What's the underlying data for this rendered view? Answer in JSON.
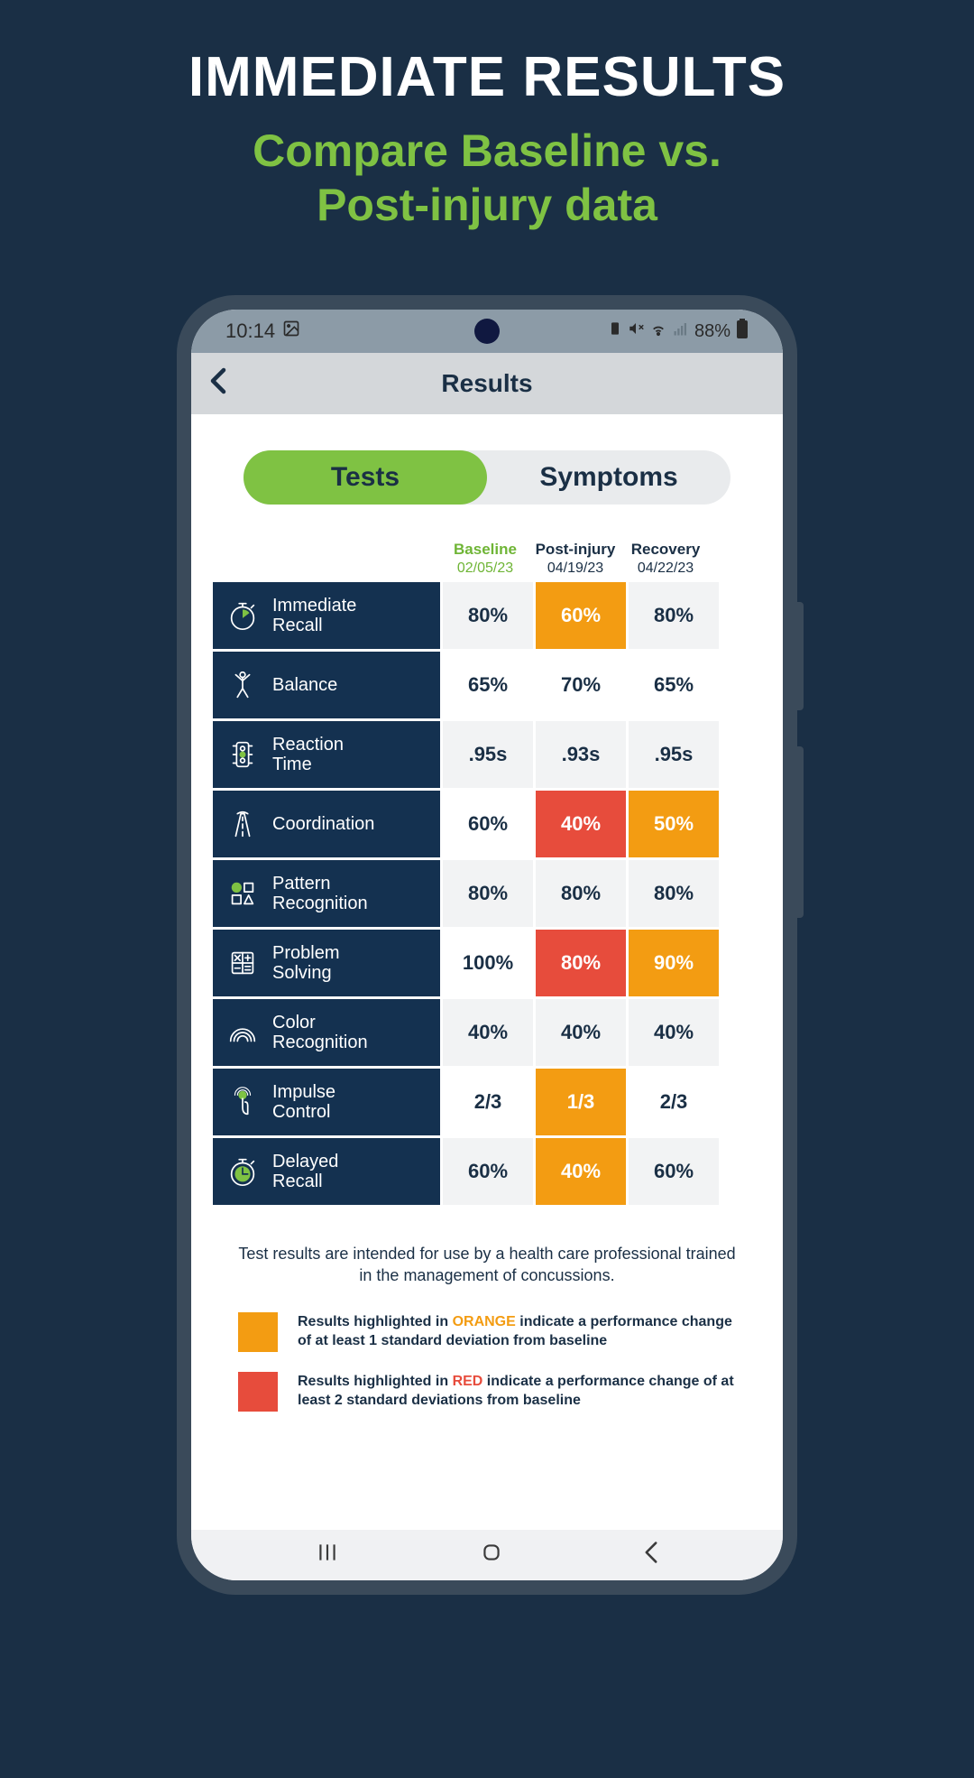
{
  "promo": {
    "title": "IMMEDIATE RESULTS",
    "subtitle_l1": "Compare Baseline vs.",
    "subtitle_l2": "Post-injury data"
  },
  "status": {
    "time": "10:14",
    "battery": "88%"
  },
  "header": {
    "title": "Results"
  },
  "segments": {
    "tests": "Tests",
    "symptoms": "Symptoms"
  },
  "columns": [
    {
      "title": "Baseline",
      "date": "02/05/23"
    },
    {
      "title": "Post-injury",
      "date": "04/19/23"
    },
    {
      "title": "Recovery",
      "date": "04/22/23"
    }
  ],
  "rows": [
    {
      "icon": "stopwatch",
      "name_l1": "Immediate",
      "name_l2": "Recall",
      "cells": [
        {
          "v": "80%",
          "s": ""
        },
        {
          "v": "60%",
          "s": "orange"
        },
        {
          "v": "80%",
          "s": ""
        }
      ]
    },
    {
      "icon": "balance",
      "name_l1": "Balance",
      "name_l2": "",
      "cells": [
        {
          "v": "65%",
          "s": ""
        },
        {
          "v": "70%",
          "s": ""
        },
        {
          "v": "65%",
          "s": ""
        }
      ]
    },
    {
      "icon": "traffic",
      "name_l1": "Reaction",
      "name_l2": "Time",
      "cells": [
        {
          "v": ".95s",
          "s": ""
        },
        {
          "v": ".93s",
          "s": ""
        },
        {
          "v": ".95s",
          "s": ""
        }
      ]
    },
    {
      "icon": "road",
      "name_l1": "Coordination",
      "name_l2": "",
      "cells": [
        {
          "v": "60%",
          "s": ""
        },
        {
          "v": "40%",
          "s": "red"
        },
        {
          "v": "50%",
          "s": "orange"
        }
      ]
    },
    {
      "icon": "shapes",
      "name_l1": "Pattern",
      "name_l2": "Recognition",
      "cells": [
        {
          "v": "80%",
          "s": ""
        },
        {
          "v": "80%",
          "s": ""
        },
        {
          "v": "80%",
          "s": ""
        }
      ]
    },
    {
      "icon": "calc",
      "name_l1": "Problem",
      "name_l2": "Solving",
      "cells": [
        {
          "v": "100%",
          "s": ""
        },
        {
          "v": "80%",
          "s": "red"
        },
        {
          "v": "90%",
          "s": "orange"
        }
      ]
    },
    {
      "icon": "rainbow",
      "name_l1": "Color",
      "name_l2": "Recognition",
      "cells": [
        {
          "v": "40%",
          "s": ""
        },
        {
          "v": "40%",
          "s": ""
        },
        {
          "v": "40%",
          "s": ""
        }
      ]
    },
    {
      "icon": "tap",
      "name_l1": "Impulse",
      "name_l2": "Control",
      "cells": [
        {
          "v": "2/3",
          "s": ""
        },
        {
          "v": "1/3",
          "s": "orange"
        },
        {
          "v": "2/3",
          "s": ""
        }
      ]
    },
    {
      "icon": "stopwatch2",
      "name_l1": "Delayed",
      "name_l2": "Recall",
      "cells": [
        {
          "v": "60%",
          "s": ""
        },
        {
          "v": "40%",
          "s": "orange"
        },
        {
          "v": "60%",
          "s": ""
        }
      ]
    }
  ],
  "disclaimer": "Test results are intended for use by a health care professional trained in the management of concussions.",
  "legend": {
    "orange_pre": "Results highlighted in ",
    "orange_kw": "ORANGE",
    "orange_post": " indicate a performance change of at least 1 standard deviation from baseline",
    "red_pre": "Results highlighted in ",
    "red_kw": "RED",
    "red_post": " indicate a performance change of at least 2 standard deviations from baseline"
  }
}
